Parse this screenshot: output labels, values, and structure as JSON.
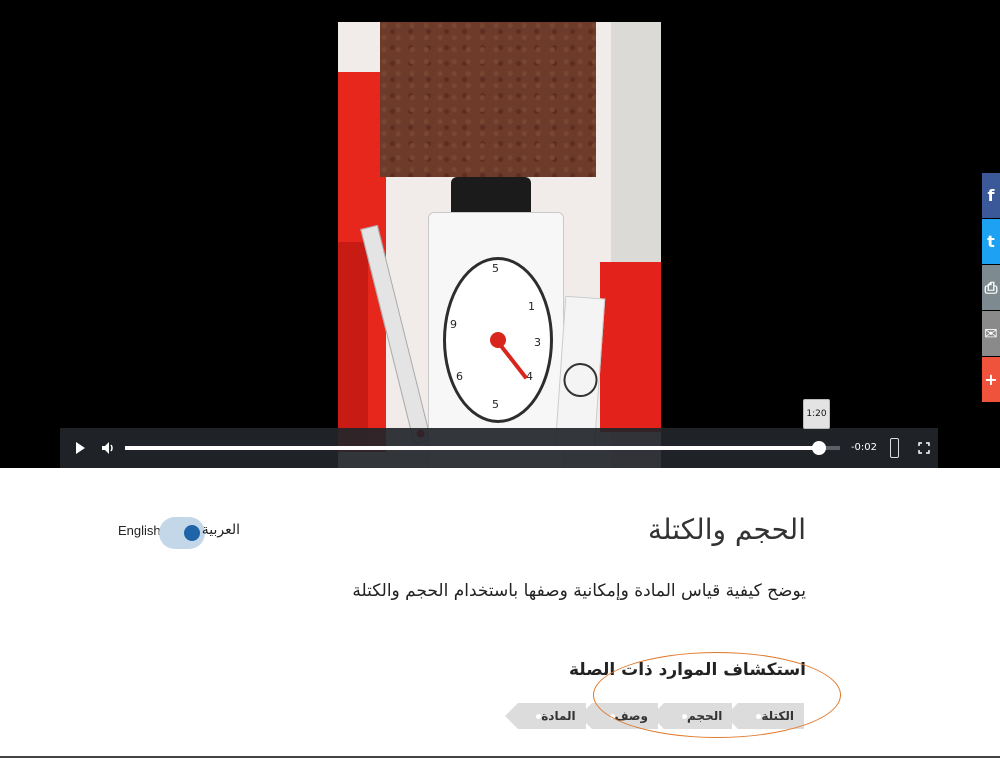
{
  "player": {
    "time_remaining": "-0:02",
    "tooltip_time": "1:20",
    "progress": 0.97
  },
  "share": [
    {
      "icon": "facebook-icon",
      "glyph": "f",
      "color": "#3b5998"
    },
    {
      "icon": "twitter-icon",
      "glyph": "t",
      "color": "#1da1f2"
    },
    {
      "icon": "print-icon",
      "glyph": "⎙",
      "color": "#7d8a8f"
    },
    {
      "icon": "email-icon",
      "glyph": "✉",
      "color": "#8a8a8a"
    },
    {
      "icon": "more-icon",
      "glyph": "+",
      "color": "#f0533c"
    }
  ],
  "content": {
    "title": "الحجم والكتلة",
    "description": "يوضح كيفية قياس المادة وإمكانية وصفها باستخدام الحجم والكتلة",
    "language": {
      "english_label": "English",
      "arabic_label": "العربية"
    },
    "related_heading": "استكشاف الموارد ذات الصلة",
    "tags": [
      "الكتلة",
      "الحجم",
      "وصف",
      "المادة"
    ]
  },
  "colors": {
    "accent_ring": "#e0782a",
    "toggle_knob": "#1e64a6"
  }
}
